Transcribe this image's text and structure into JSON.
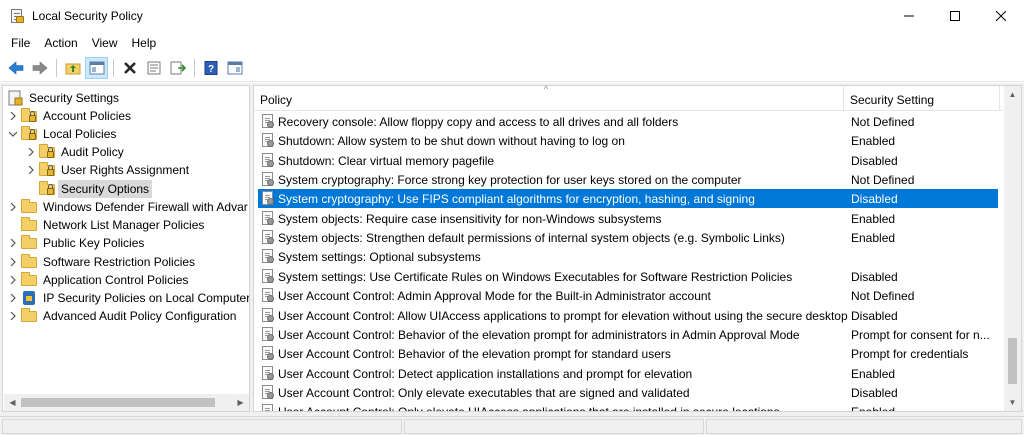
{
  "window": {
    "title": "Local Security Policy",
    "icon": "security-policy-icon"
  },
  "menu": [
    "File",
    "Action",
    "View",
    "Help"
  ],
  "toolbar": {
    "buttons": [
      "back-icon",
      "forward-icon",
      "up-folder-icon",
      "show-hide-tree-icon",
      "delete-icon",
      "properties-icon",
      "export-list-icon",
      "help-icon",
      "console-tree-icon"
    ]
  },
  "tree": {
    "items": [
      {
        "label": "Security Settings",
        "icon": "security-settings-icon"
      },
      {
        "label": "Account Policies",
        "icon": "folder-lock-icon"
      },
      {
        "label": "Local Policies",
        "icon": "folder-lock-icon"
      },
      {
        "label": "Audit Policy",
        "icon": "folder-lock-icon"
      },
      {
        "label": "User Rights Assignment",
        "icon": "folder-lock-icon"
      },
      {
        "label": "Security Options",
        "icon": "folder-lock-icon",
        "selected": true
      },
      {
        "label": "Windows Defender Firewall with Advar",
        "icon": "folder-icon"
      },
      {
        "label": "Network List Manager Policies",
        "icon": "folder-icon"
      },
      {
        "label": "Public Key Policies",
        "icon": "folder-icon"
      },
      {
        "label": "Software Restriction Policies",
        "icon": "folder-icon"
      },
      {
        "label": "Application Control Policies",
        "icon": "folder-icon"
      },
      {
        "label": "IP Security Policies on Local Computer",
        "icon": "ipsec-icon"
      },
      {
        "label": "Advanced Audit Policy Configuration",
        "icon": "folder-icon"
      }
    ]
  },
  "list": {
    "columns": {
      "policy": "Policy",
      "setting": "Security Setting"
    },
    "rows": [
      {
        "policy": "Recovery console: Allow floppy copy and access to all drives and all folders",
        "setting": "Not Defined"
      },
      {
        "policy": "Shutdown: Allow system to be shut down without having to log on",
        "setting": "Enabled"
      },
      {
        "policy": "Shutdown: Clear virtual memory pagefile",
        "setting": "Disabled"
      },
      {
        "policy": "System cryptography: Force strong key protection for user keys stored on the computer",
        "setting": "Not Defined"
      },
      {
        "policy": "System cryptography: Use FIPS compliant algorithms for encryption, hashing, and signing",
        "setting": "Disabled",
        "selected": true
      },
      {
        "policy": "System objects: Require case insensitivity for non-Windows subsystems",
        "setting": "Enabled"
      },
      {
        "policy": "System objects: Strengthen default permissions of internal system objects (e.g. Symbolic Links)",
        "setting": "Enabled"
      },
      {
        "policy": "System settings: Optional subsystems",
        "setting": ""
      },
      {
        "policy": "System settings: Use Certificate Rules on Windows Executables for Software Restriction Policies",
        "setting": "Disabled"
      },
      {
        "policy": "User Account Control: Admin Approval Mode for the Built-in Administrator account",
        "setting": "Not Defined"
      },
      {
        "policy": "User Account Control: Allow UIAccess applications to prompt for elevation without using the secure desktop",
        "setting": "Disabled"
      },
      {
        "policy": "User Account Control: Behavior of the elevation prompt for administrators in Admin Approval Mode",
        "setting": "Prompt for consent for n..."
      },
      {
        "policy": "User Account Control: Behavior of the elevation prompt for standard users",
        "setting": "Prompt for credentials"
      },
      {
        "policy": "User Account Control: Detect application installations and prompt for elevation",
        "setting": "Enabled"
      },
      {
        "policy": "User Account Control: Only elevate executables that are signed and validated",
        "setting": "Disabled"
      },
      {
        "policy": "User Account Control: Only elevate UIAccess applications that are installed in secure locations",
        "setting": "Enabled"
      }
    ]
  },
  "colors": {
    "selection": "#0078d7",
    "tree_selection": "#d9d9d9",
    "chrome": "#f0f0f0"
  }
}
